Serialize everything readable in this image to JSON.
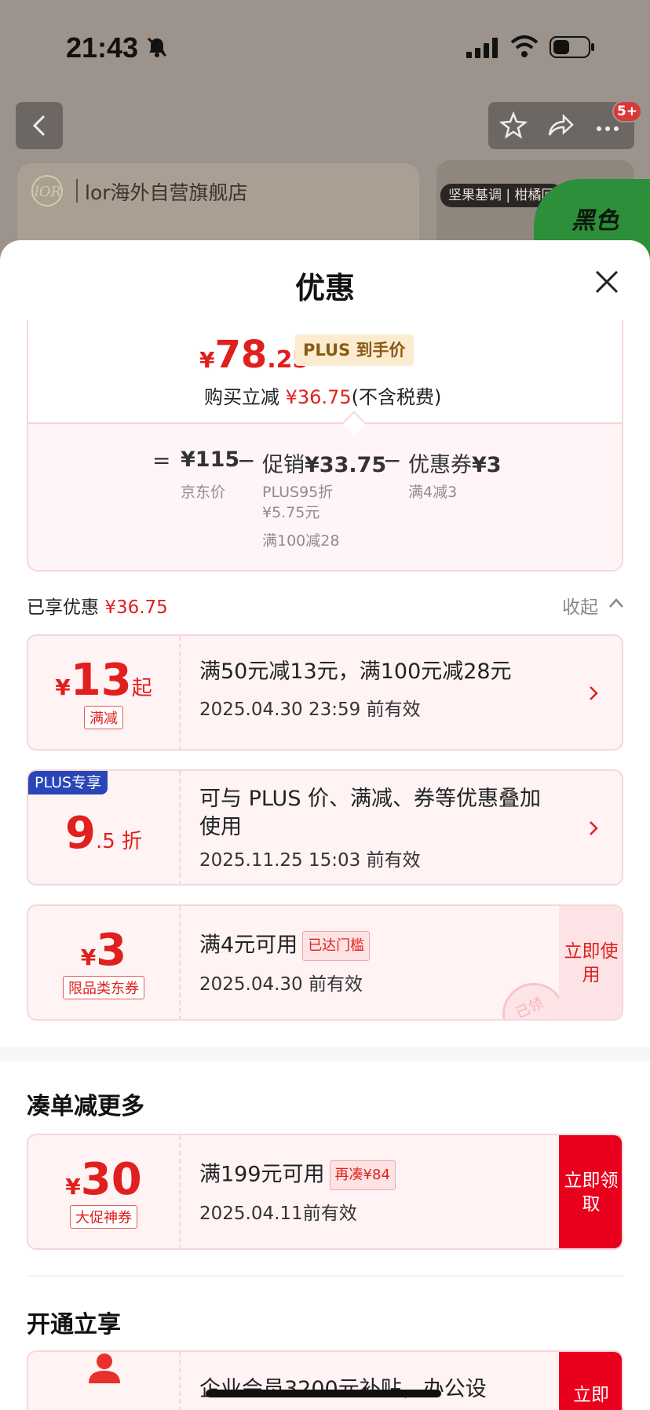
{
  "status_bar": {
    "time": "21:43"
  },
  "background": {
    "store_name": "lor海外自营旗舰店",
    "chip": "坚果基调 | 柑橘回",
    "promo_text": "黑色",
    "badge": "5+"
  },
  "sheet": {
    "title": "优惠",
    "summary": {
      "currency": "¥",
      "price_int": "78",
      "price_dec": ".25",
      "plus_tag": "PLUS 到手价",
      "reduce_prefix": "购买立减 ",
      "reduce_amount": "¥36.75",
      "reduce_suffix": "(不含税费)"
    },
    "formula": {
      "eq": "=",
      "jd_price": "¥115",
      "jd_label": "京东价",
      "minus1": "−",
      "promo_label": "促销",
      "promo_value": "¥33.75",
      "promo_sub1": "PLUS95折",
      "promo_sub2": "¥5.75元",
      "promo_sub3": "满100减28",
      "minus2": "−",
      "coupon_label": "优惠券",
      "coupon_value": "¥3",
      "coupon_sub": "满4减3"
    },
    "enjoyed": {
      "label": "已享优惠 ",
      "amount": "¥36.75",
      "collapse": "收起"
    },
    "coupons": [
      {
        "symbol": "¥",
        "value": "13",
        "suffix": "起",
        "tag": "满减",
        "title": "满50元减13元，满100元减28元",
        "date": "2025.04.30 23:59 前有效"
      },
      {
        "corner": "PLUS专享",
        "value": "9",
        "suffix": ".5 折",
        "title": "可与 PLUS 价、满减、券等优惠叠加使用",
        "date": "2025.11.25 15:03 前有效"
      },
      {
        "symbol": "¥",
        "value": "3",
        "tag": "限品类东券",
        "title": "满4元可用",
        "threshold": "已达门槛",
        "date": "2025.04.30 前有效",
        "button": "立即使用",
        "stamp": "已领"
      }
    ],
    "more_section": {
      "title": "凑单减更多",
      "coupon": {
        "symbol": "¥",
        "value": "30",
        "tag": "大促神券",
        "title": "满199元可用",
        "threshold": "再凑¥84",
        "date": "2025.04.11前有效",
        "button": "立即领取"
      }
    },
    "open_section": {
      "title": "开通立享",
      "item_title": "企业会员3200元补贴，办公设",
      "button": "立即"
    }
  }
}
